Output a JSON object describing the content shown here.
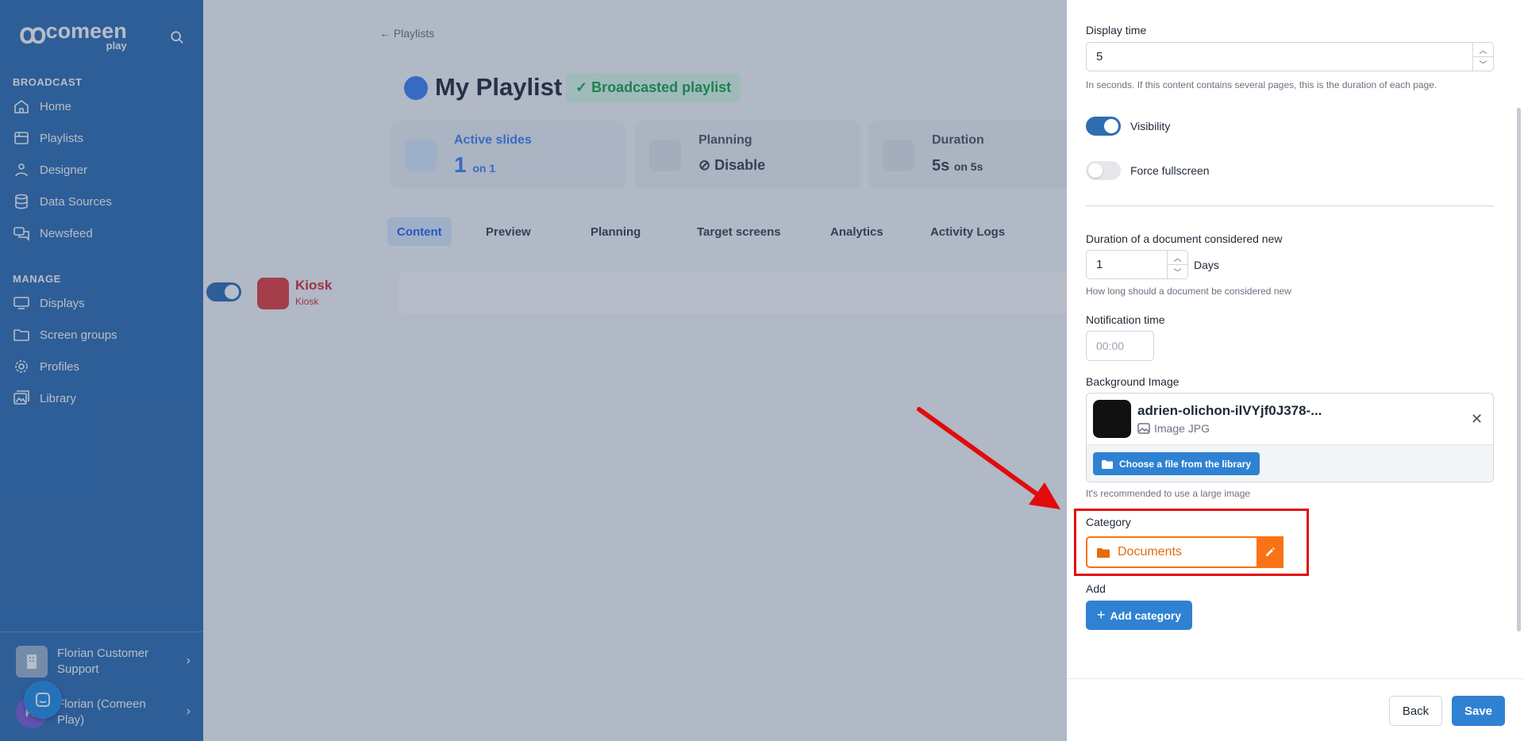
{
  "sidebar": {
    "logo_text": "comeen",
    "logo_sub": "play",
    "sections": [
      {
        "title": "BROADCAST",
        "items": [
          {
            "label": "Home",
            "icon": "home-icon"
          },
          {
            "label": "Playlists",
            "icon": "playlist-icon"
          },
          {
            "label": "Designer",
            "icon": "designer-icon"
          },
          {
            "label": "Data Sources",
            "icon": "database-icon"
          },
          {
            "label": "Newsfeed",
            "icon": "newsfeed-icon"
          }
        ]
      },
      {
        "title": "MANAGE",
        "items": [
          {
            "label": "Displays",
            "icon": "monitor-icon"
          },
          {
            "label": "Screen groups",
            "icon": "folder-icon"
          },
          {
            "label": "Profiles",
            "icon": "gear-icon"
          },
          {
            "label": "Library",
            "icon": "library-icon"
          }
        ]
      }
    ],
    "accounts": [
      {
        "name": "Florian Customer Support"
      },
      {
        "name": "Florian (Comeen Play)",
        "initials": "FL"
      }
    ]
  },
  "main": {
    "back_label": "Playlists",
    "title": "My Playlist",
    "badge": "Broadcasted playlist",
    "stats": [
      {
        "label": "Active slides",
        "value": "1",
        "suffix": "on 1"
      },
      {
        "label": "Planning",
        "value": "Disable",
        "suffix": ""
      },
      {
        "label": "Duration",
        "value": "5s",
        "suffix": "on 5s"
      }
    ],
    "tabs": [
      "Content",
      "Preview",
      "Planning",
      "Target screens",
      "Analytics",
      "Activity Logs"
    ],
    "content_item": {
      "title": "Kiosk",
      "subtitle": "Kiosk"
    }
  },
  "panel": {
    "display_time": {
      "label": "Display time",
      "value": "5",
      "help": "In seconds. If this content contains several pages, this is the duration of each page."
    },
    "visibility": {
      "label": "Visibility",
      "on": true
    },
    "force_fullscreen": {
      "label": "Force fullscreen",
      "on": false
    },
    "new_duration": {
      "label": "Duration of a document considered new",
      "value": "1",
      "unit": "Days",
      "help": "How long should a document be considered new"
    },
    "notification_time": {
      "label": "Notification time",
      "placeholder": "00:00"
    },
    "background_image": {
      "label": "Background Image",
      "file_name": "adrien-olichon-ilVYjf0J378-...",
      "file_type": "Image JPG",
      "choose_label": "Choose a file from the library",
      "help": "It's recommended to use a large image"
    },
    "category": {
      "label": "Category",
      "value": "Documents"
    },
    "add": {
      "label": "Add",
      "button": "Add category"
    },
    "footer": {
      "back": "Back",
      "save": "Save"
    }
  },
  "colors": {
    "primary": "#2f82d2",
    "sidebar": "#2f6db3",
    "category_orange": "#f97316",
    "highlight_red": "#e10b0b"
  }
}
